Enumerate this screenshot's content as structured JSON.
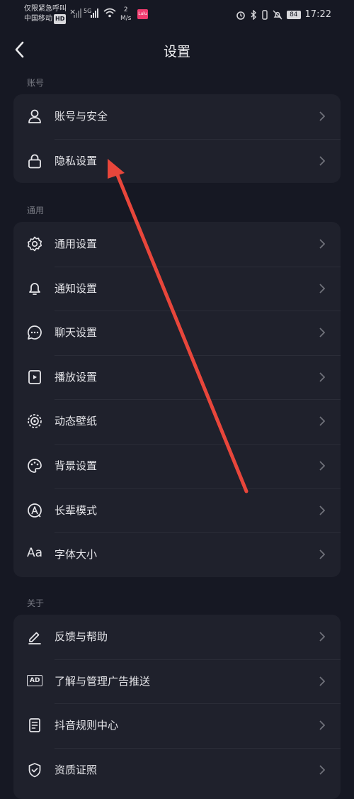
{
  "status_bar": {
    "line1": "仅限紧急呼叫",
    "line2": "中国移动",
    "hd": "HD",
    "x": "×",
    "net": "5G",
    "speed_value": "2",
    "speed_unit": "M/s",
    "app": "Lulu",
    "battery": "84",
    "time": "17:22"
  },
  "nav": {
    "title": "设置"
  },
  "sections": [
    {
      "label": "账号",
      "items": [
        {
          "label": "账号与安全"
        },
        {
          "label": "隐私设置"
        }
      ]
    },
    {
      "label": "通用",
      "items": [
        {
          "label": "通用设置"
        },
        {
          "label": "通知设置"
        },
        {
          "label": "聊天设置"
        },
        {
          "label": "播放设置"
        },
        {
          "label": "动态壁纸"
        },
        {
          "label": "背景设置"
        },
        {
          "label": "长辈模式"
        },
        {
          "label": "字体大小"
        }
      ]
    },
    {
      "label": "关于",
      "items": [
        {
          "label": "反馈与帮助"
        },
        {
          "label": "了解与管理广告推送"
        },
        {
          "label": "抖音规则中心"
        },
        {
          "label": "资质证照"
        }
      ]
    }
  ],
  "icons": {
    "font_size_glyph": "Aa",
    "ad_glyph": "AD"
  },
  "colors": {
    "background": "#161823",
    "card": "#1f212c",
    "arrow": "#e8463b"
  }
}
